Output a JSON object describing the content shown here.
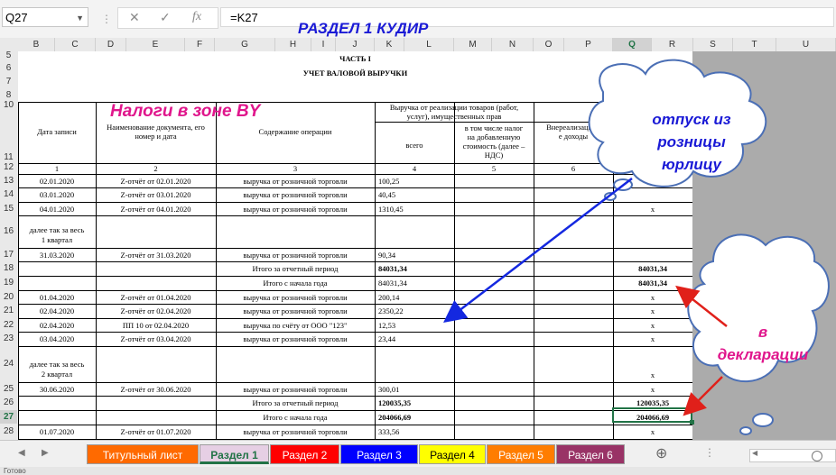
{
  "formula_bar": {
    "name_box": "Q27",
    "formula": "=K27"
  },
  "columns": [
    "B",
    "C",
    "D",
    "E",
    "F",
    "G",
    "H",
    "I",
    "J",
    "K",
    "L",
    "M",
    "N",
    "O",
    "P",
    "Q",
    "R",
    "S",
    "T",
    "U"
  ],
  "rows": [
    "5",
    "6",
    "7",
    "8",
    "10",
    "11",
    "12",
    "13",
    "14",
    "15",
    "16",
    "17",
    "18",
    "19",
    "20",
    "21",
    "22",
    "23",
    "24",
    "25",
    "26",
    "27",
    "28"
  ],
  "doc": {
    "part": "ЧАСТЬ I",
    "title": "УЧЕТ ВАЛОВОЙ ВЫРУЧКИ",
    "headers": {
      "date": "Дата записи",
      "doc_name": [
        "Наименование документа, его",
        "номер и дата"
      ],
      "operation": "Содержание операции",
      "revenue": [
        "Выручка от реализации товаров (работ,",
        "услуг), имущественных прав"
      ],
      "total": "всего",
      "vat": [
        "в том числе налог",
        "на добавленную",
        "стоимость (далее –",
        "НДС)"
      ],
      "nonop": [
        "Внереализацион",
        "е доходы"
      ]
    },
    "col_numbers": [
      "1",
      "2",
      "3",
      "4",
      "5",
      "6"
    ],
    "rows": [
      {
        "date": "02.01.2020",
        "doc": "Z-отчёт от 02.01.2020",
        "op": "выручка от розничной торговли",
        "total": "100,25",
        "q": ""
      },
      {
        "date": "03.01.2020",
        "doc": "Z-отчёт от 03.01.2020",
        "op": "выручка от розничной торговли",
        "total": "40,45",
        "q": ""
      },
      {
        "date": "04.01.2020",
        "doc": "Z-отчёт от 04.01.2020",
        "op": "выручка от розничной торговли",
        "total": "1310,45",
        "q": "x"
      },
      {
        "date": "31.03.2020",
        "doc": "Z-отчёт от 31.03.2020",
        "op": "выручка от розничной торговли",
        "total": "90,34",
        "q": ""
      },
      {
        "op": "Итого за отчетный период",
        "total": "84031,34",
        "q": "84031,34"
      },
      {
        "op": "Итого с начала года",
        "total": "84031,34",
        "q": "84031,34"
      },
      {
        "date": "01.04.2020",
        "doc": "Z-отчёт от 01.04.2020",
        "op": "выручка от розничной торговли",
        "total": "200,14",
        "q": "x"
      },
      {
        "date": "02.04.2020",
        "doc": "Z-отчёт от 02.04.2020",
        "op": "выручка от розничной торговли",
        "total": "2350,22",
        "q": "x"
      },
      {
        "date": "02.04.2020",
        "doc": "ПП 10 от 02.04.2020",
        "op": "выручка по счёту от ООО \"123\"",
        "total": "12,53",
        "q": "x"
      },
      {
        "date": "03.04.2020",
        "doc": "Z-отчёт от 03.04.2020",
        "op": "выручка от розничной торговли",
        "total": "23,44",
        "q": "x"
      },
      {
        "date": "30.06.2020",
        "doc": "Z-отчёт от 30.06.2020",
        "op": "выручка от розничной торговли",
        "total": "300,01",
        "q": "x"
      },
      {
        "op": "Итого за отчетный период",
        "total": "120035,35",
        "q": "120035,35"
      },
      {
        "op": "Итого с начала года",
        "total": "204066,69",
        "q": "204066,69"
      },
      {
        "date": "01.07.2020",
        "doc": "Z-отчёт от 01.07.2020",
        "op": "выручка от розничной торговли",
        "total": "333,56",
        "q": "x"
      }
    ],
    "quarter1": [
      "далее так за весь",
      "1 квартал"
    ],
    "quarter2": [
      "далее так за весь",
      "2 квартал"
    ],
    "x_mark": "x"
  },
  "annotations": {
    "title": "РАЗДЕЛ 1 КУДИР",
    "watermark": "Налоги в зоне BY",
    "cloud1": [
      "отпуск из",
      "розницы",
      "юрлицу"
    ],
    "cloud2": [
      "в",
      "декларации"
    ]
  },
  "colors": {
    "accent": "#217346",
    "annotation_blue": "#1a1ad6",
    "annotation_pink": "#e0168c",
    "arrow_red": "#e0201a",
    "arrow_blue": "#1428e0",
    "cloud_border": "#4b6fb5"
  },
  "tabs": [
    {
      "label": "Титульный лист",
      "bg": "#ff6a00",
      "fg": "#ffffff"
    },
    {
      "label": "Раздел 1",
      "bg": "#e6cfe4",
      "fg": "#217346"
    },
    {
      "label": "Раздел 2",
      "bg": "#ff0000",
      "fg": "#ffffff"
    },
    {
      "label": "Раздел 3",
      "bg": "#0000ff",
      "fg": "#ffffff"
    },
    {
      "label": "Раздел 4",
      "bg": "#ffff00",
      "fg": "#000000"
    },
    {
      "label": "Раздел 5",
      "bg": "#ff7d00",
      "fg": "#ffffff"
    },
    {
      "label": "Раздел 6",
      "bg": "#993366",
      "fg": "#ffffff"
    }
  ],
  "status": "Готово"
}
